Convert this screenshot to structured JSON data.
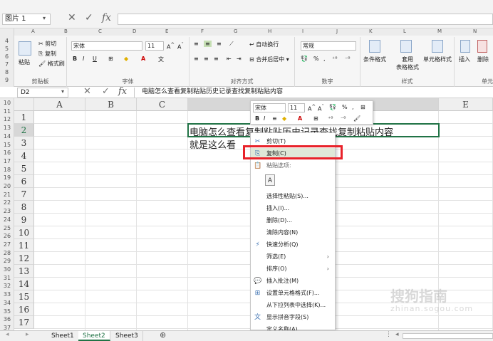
{
  "outer": {
    "name_box": "图片 1"
  },
  "ribbon": {
    "clipboard": {
      "paste": "粘贴",
      "cut": "剪切",
      "copy": "复制",
      "format_painter": "格式刷",
      "label": "剪贴板"
    },
    "font": {
      "name": "宋体",
      "size": "11",
      "label": "字体"
    },
    "alignment": {
      "wrap": "自动换行",
      "merge": "合并后居中",
      "label": "对齐方式"
    },
    "number": {
      "format": "常规",
      "label": "数字"
    },
    "styles": {
      "cond": "条件格式",
      "table": "套用\n表格格式",
      "cell": "单元格样式",
      "label": "样式"
    },
    "cells": {
      "insert": "插入",
      "delete": "删除",
      "label": "单元"
    }
  },
  "formula_bar": {
    "name": "D2",
    "content": "电脑怎么查看复制粘贴历史记录查找复制粘贴内容"
  },
  "columns": [
    "A",
    "B",
    "C",
    "D",
    "E"
  ],
  "rows": [
    "1",
    "2",
    "3",
    "4",
    "5",
    "6",
    "7",
    "8",
    "9",
    "10",
    "11",
    "12",
    "13",
    "14",
    "15",
    "16",
    "17"
  ],
  "outer_rows": [
    "10",
    "11",
    "12",
    "13",
    "14",
    "15",
    "16",
    "17",
    "18",
    "19",
    "20",
    "21",
    "22",
    "23",
    "24",
    "25",
    "26",
    "27",
    "28",
    "29",
    "30",
    "31",
    "32",
    "33",
    "34",
    "35",
    "36",
    "37"
  ],
  "cells": {
    "d2": "电脑怎么查看复制粘贴历史记录查找复制粘贴内容",
    "d3": "就是这么看"
  },
  "mini_toolbar": {
    "font": "宋体",
    "size": "11"
  },
  "context_menu": [
    {
      "label": "剪切(T)",
      "icon": "scissors-icon"
    },
    {
      "label": "复制(C)",
      "icon": "copy-icon",
      "highlighted": true
    },
    {
      "label": "粘贴选项:",
      "icon": "paste-icon",
      "header": true
    },
    {
      "label": "",
      "icon": "paste-values-icon",
      "spacer": true
    },
    {
      "label": "选择性粘贴(S)...",
      "icon": ""
    },
    {
      "label": "插入(I)...",
      "icon": ""
    },
    {
      "label": "删除(D)...",
      "icon": ""
    },
    {
      "label": "清除内容(N)",
      "icon": ""
    },
    {
      "label": "快速分析(Q)",
      "icon": "quick-analysis-icon"
    },
    {
      "label": "筛选(E)",
      "icon": "",
      "submenu": true
    },
    {
      "label": "排序(O)",
      "icon": "",
      "submenu": true
    },
    {
      "label": "插入批注(M)",
      "icon": "comment-icon"
    },
    {
      "label": "设置单元格格式(F)...",
      "icon": "format-cells-icon"
    },
    {
      "label": "从下拉列表中选择(K)...",
      "icon": ""
    },
    {
      "label": "显示拼音字段(S)",
      "icon": "phonetic-icon"
    },
    {
      "label": "定义名称(A)...",
      "icon": ""
    }
  ],
  "sheets": [
    "Sheet1",
    "Sheet2",
    "Sheet3"
  ],
  "active_sheet": "Sheet2",
  "watermark": {
    "line1": "搜狗指南",
    "line2": "zhinan.sogou.com"
  },
  "colors": {
    "accent": "#217346",
    "highlight": "#e8222a"
  }
}
